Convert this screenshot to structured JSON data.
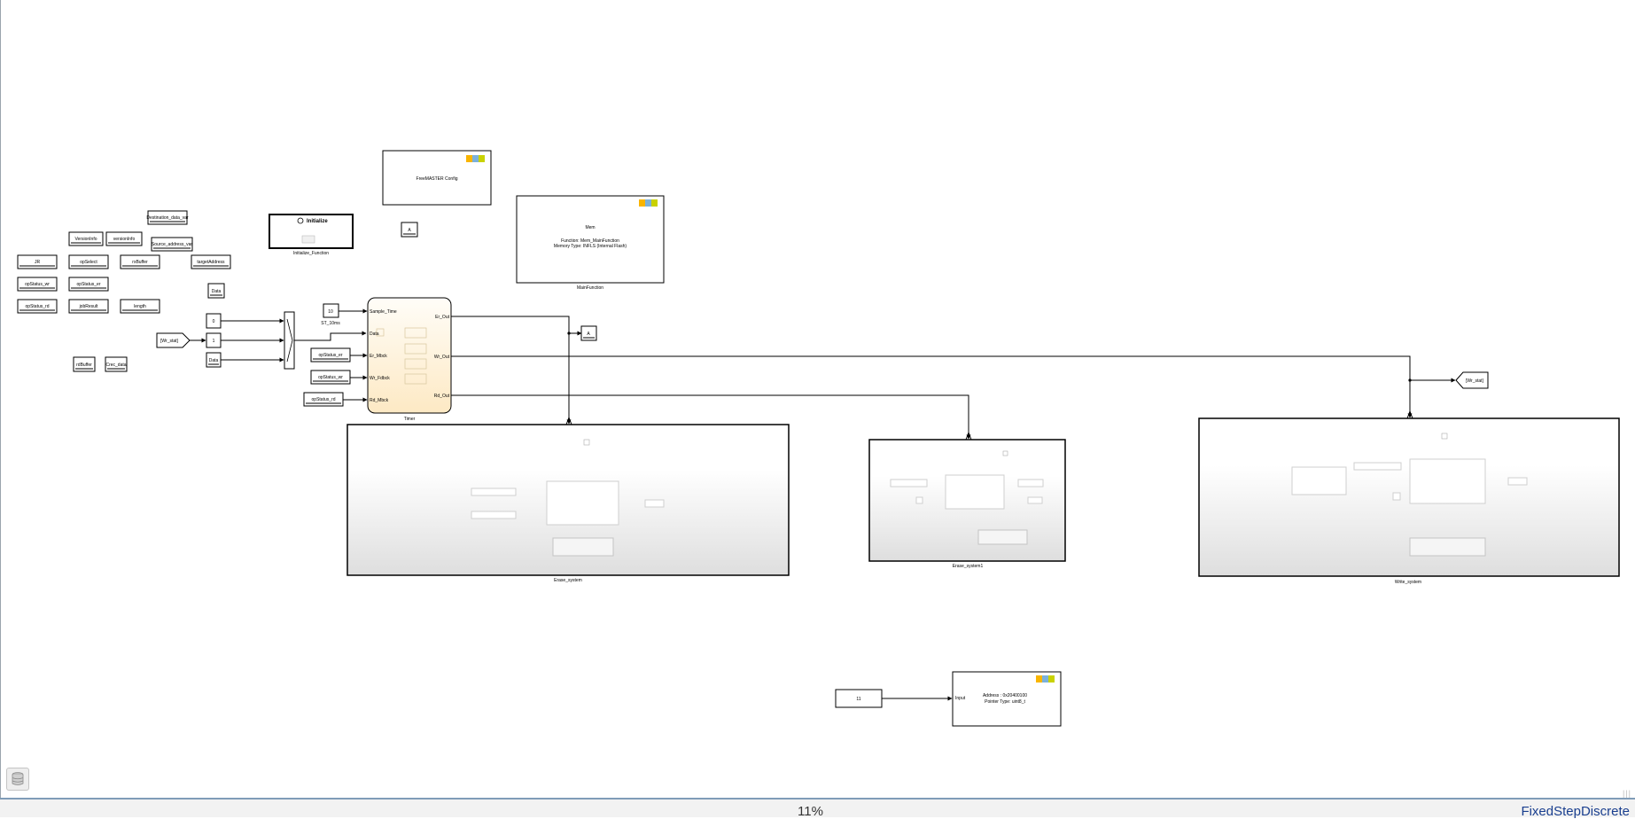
{
  "tags": {
    "destination": "Destination_data_var",
    "versioninfo_left": "VersionInfo",
    "versioninfo_right": "versionInfo",
    "source": "Source_address_var",
    "jr": "JR",
    "opselect": "opSelect",
    "rxbuffer": "rxBuffer",
    "targetaddress": "targetAddress",
    "opstatus_wr": "opStatus_wr",
    "opstatus_er": "opStatus_er",
    "opstatus_rd": "opStatus_rd",
    "jobresult": "jobResult",
    "length": "length",
    "rdbuffer": "rdBuffer",
    "crec_data": "Crec_data"
  },
  "initialize": {
    "title": "Initialize",
    "caption": "Initialize_Function"
  },
  "freemaster": {
    "label": "FreeMASTER Config"
  },
  "mem": {
    "title": "Mem",
    "function": "Function: Mem_MainFunction",
    "memory_type": "Memory Type: INFLS (Internal Flash)",
    "caption": "MainFunction"
  },
  "goto_a": "A",
  "from_a": "A",
  "from_a_small": "A",
  "data_top": "Data",
  "data_bottom": "Data",
  "const_zero": "0",
  "const_one": "1",
  "wr_stat_from": "[Wr_stat]",
  "wr_stat_goto": "[Wr_stat]",
  "sample_const": "10",
  "sample_caption": "ST_10ms",
  "timer": {
    "caption": "Timer",
    "in_sample": "Sample_Time",
    "in_data": "Data",
    "in_er": "Er_Mbck",
    "in_wr": "Wr_Fdbck",
    "in_rd": "Rd_Mbck",
    "out_er": "Er_Out",
    "out_wr": "Wr_Out",
    "out_rd": "Rd_Out"
  },
  "from_er_timer": "opStatus_er",
  "from_wr_timer": "opStatus_wr",
  "from_rd_timer": "opStatus_rd",
  "erase_caption": "Erase_system",
  "erase1_caption": "Erase_system1",
  "write_caption": "Write_system",
  "const_11": "11",
  "ptr_block": {
    "input": "Input",
    "address": "Address : 0x20400100",
    "pointer_type": "Pointer Type: uint8_t"
  },
  "nxp_logo": "NXP",
  "status": {
    "zoom": "11%",
    "solver": "FixedStepDiscrete"
  },
  "colors": {
    "timer_fill": "#fdf2dd",
    "subsystem_gradient_end": "#dedede",
    "nxp_yellow": "#f9b500",
    "nxp_blue": "#7bb1db",
    "nxp_green": "#c9d200"
  }
}
